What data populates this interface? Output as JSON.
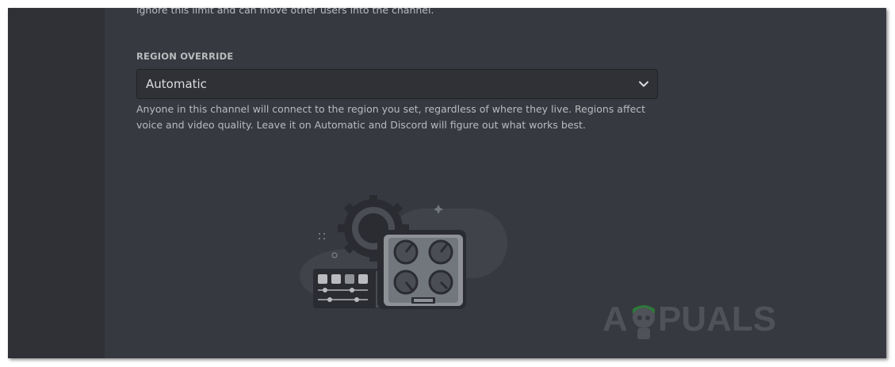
{
  "previous_section": {
    "note": "ignore this limit and can move other users into the channel."
  },
  "region_override": {
    "title": "REGION OVERRIDE",
    "selected_value": "Automatic",
    "help_text": "Anyone in this channel will connect to the region you set, regardless of where they live. Regions affect voice and video quality. Leave it on Automatic and Discord will figure out what works best."
  },
  "icons": {
    "dropdown": "chevron-down-icon",
    "illustration": "audio-mixer-illustration"
  },
  "watermark": {
    "brand": "APPUALS",
    "text_before": "A",
    "text_after": "PUALS"
  },
  "colors": {
    "background": "#36393f",
    "sidebar": "#2f3136",
    "select_background": "#2f3136",
    "text_primary": "#dcddde",
    "text_muted": "#b9bbbe"
  }
}
